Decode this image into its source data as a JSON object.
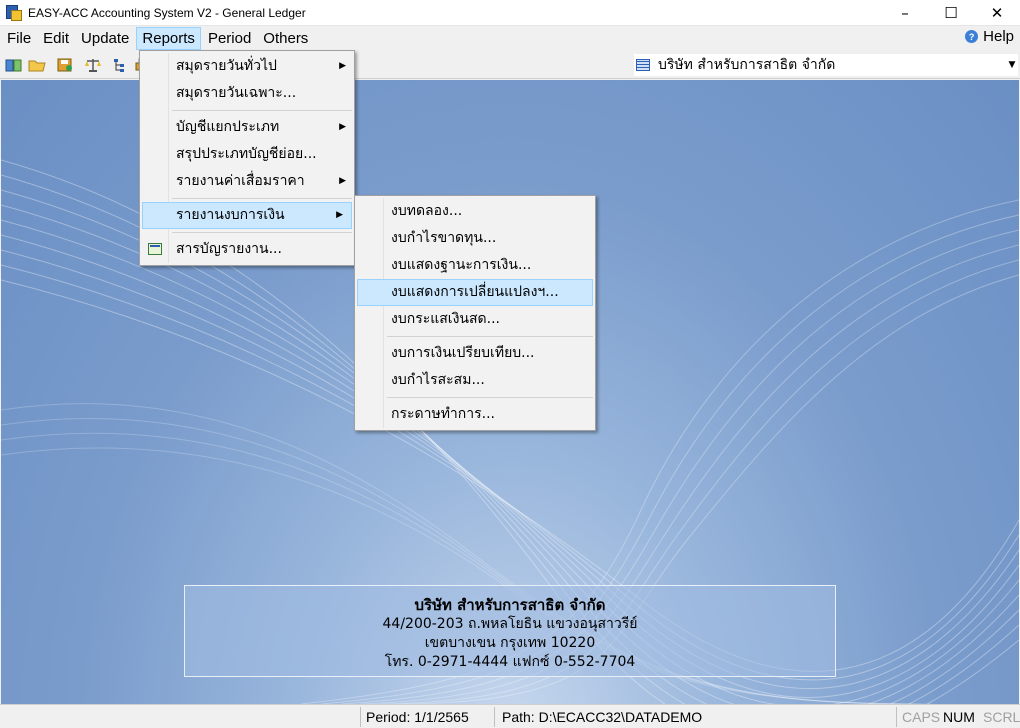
{
  "window": {
    "title": "EASY-ACC Accounting System V2 - General Ledger",
    "minimize": "–",
    "maximize": "☐",
    "close": "✕"
  },
  "menubar": {
    "items": [
      "File",
      "Edit",
      "Update",
      "Reports",
      "Period",
      "Others"
    ],
    "help": "Help"
  },
  "toolbar": {
    "icons": [
      "book-icon",
      "folder-icon",
      "save-icon",
      "scale-icon",
      "tree-icon",
      "print-icon"
    ],
    "company_select": "บริษัท สำหรับการสาธิต จำกัด"
  },
  "reports_menu": {
    "items": [
      "สมุดรายวันทั่วไป",
      "สมุดรายวันเฉพาะ...",
      "บัญชีแยกประเภท",
      "สรุปประเภทบัญชีย่อย...",
      "รายงานค่าเสื่อมราคา",
      "รายงานงบการเงิน",
      "สารบัญรายงาน..."
    ]
  },
  "financial_menu": {
    "items": [
      "งบทดลอง...",
      "งบกำไรขาดทุน...",
      "งบแสดงฐานะการเงิน...",
      "งบแสดงการเปลี่ยนแปลงฯ...",
      "งบกระแสเงินสด...",
      "งบการเงินเปรียบเทียบ...",
      "งบกำไรสะสม...",
      "กระดาษทำการ..."
    ]
  },
  "company_info": {
    "name": "บริษัท สำหรับการสาธิต จำกัด",
    "address1": "44/200-203 ถ.พหลโยธิน แขวงอนุสาวรีย์",
    "address2": "เขตบางเขน กรุงเทพ 10220",
    "phone": "โทร. 0-2971-4444 แฟกซ์ 0-552-7704"
  },
  "statusbar": {
    "period": "Period: 1/1/2565",
    "path": "Path: D:\\ECACC32\\DATADEMO",
    "caps": "CAPS",
    "num": "NUM",
    "scrl": "SCRL"
  },
  "colors": {
    "workspace": "#7a9ccc",
    "highlight": "#cce8ff",
    "highlight_border": "#99d1ff"
  }
}
